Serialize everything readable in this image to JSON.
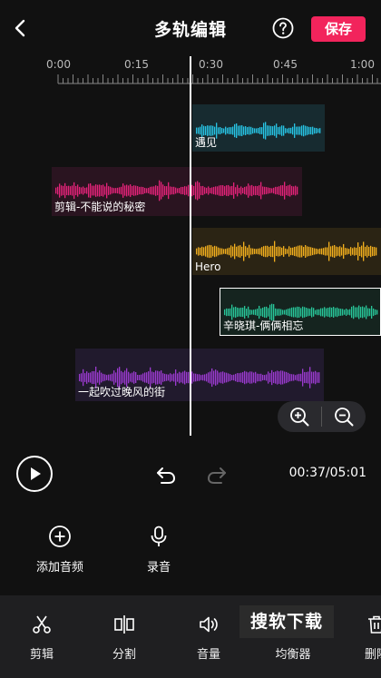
{
  "header": {
    "title": "多轨编辑",
    "save_label": "保存"
  },
  "ruler": {
    "labels": [
      "0:00",
      "0:15",
      "0:30",
      "0:45",
      "1:00"
    ]
  },
  "tracks": [
    {
      "name": "遇见",
      "color": "#27c5e6"
    },
    {
      "name": "剪辑-不能说的秘密",
      "color": "#e4237a"
    },
    {
      "name": "Hero",
      "color": "#f3b01e"
    },
    {
      "name": "辛晓琪-俩俩相忘",
      "color": "#28c79a"
    },
    {
      "name": "一起吹过晚风的街",
      "color": "#9b3ad0"
    }
  ],
  "playback": {
    "time": "00:37/05:01"
  },
  "actions": {
    "add_audio": "添加音频",
    "record": "录音"
  },
  "toolbar": {
    "trim": "剪辑",
    "split": "分割",
    "volume": "音量",
    "equalizer": "均衡器",
    "delete": "删除"
  },
  "watermark": "搜软下载",
  "colors": {
    "accent": "#f2245c",
    "background": "#111111"
  }
}
